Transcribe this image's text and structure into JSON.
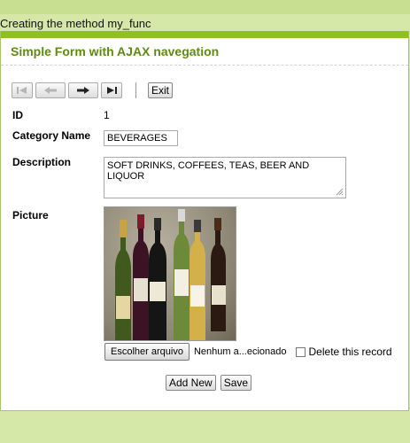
{
  "log": {
    "message": "Creating the method my_func"
  },
  "form": {
    "title": "Simple Form with AJAX navegation",
    "toolbar": {
      "exit_label": "Exit"
    },
    "fields": {
      "id": {
        "label": "ID",
        "value": "1"
      },
      "category_name": {
        "label": "Category Name",
        "value": "BEVERAGES"
      },
      "description": {
        "label": "Description",
        "value": "SOFT DRINKS, COFFEES, TEAS, BEER AND LIQUOR"
      },
      "picture": {
        "label": "Picture",
        "choose_file_label": "Escolher arquivo",
        "file_status": "Nenhum a...ecionado"
      }
    },
    "delete_label": "Delete this record",
    "actions": {
      "add_new_label": "Add New",
      "save_label": "Save"
    }
  },
  "colors": {
    "accent": "#8fc020",
    "title": "#5f8a14",
    "background": "#d6e8a8"
  },
  "icons": [
    "first-record-icon",
    "previous-record-icon",
    "next-record-icon",
    "last-record-icon",
    "resize-grip-icon"
  ]
}
